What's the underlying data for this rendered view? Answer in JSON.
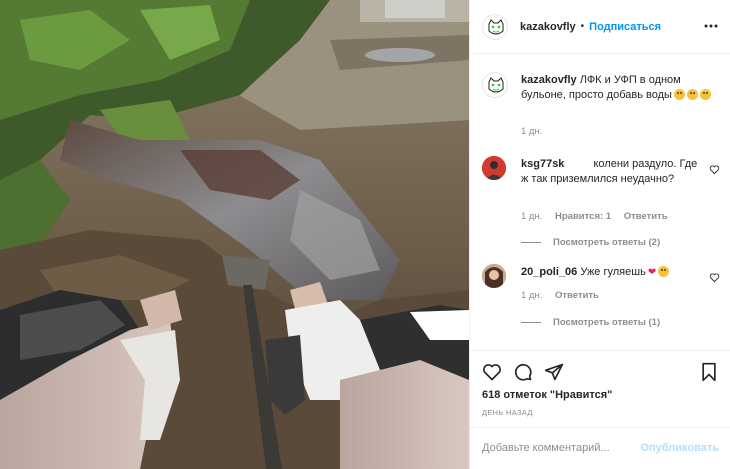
{
  "post": {
    "username": "kazakovfly",
    "follow_label": "Подписаться",
    "separator": "•",
    "more_icon": "more-horizontal-icon",
    "caption": {
      "username": "kazakovfly",
      "text": "ЛФК и УФП в одном бульоне, просто добавь воды",
      "time": "1 дн."
    },
    "comments": [
      {
        "username": "ksg77sk",
        "text": "колени раздуло. Где ж так приземлился неудачно?",
        "time": "1 дн.",
        "likes": "Нравится: 1",
        "reply_label": "Ответить",
        "replies_label": "Посмотреть ответы (2)"
      },
      {
        "username": "20_poli_06",
        "text": "Уже гуляешь",
        "time": "1 дн.",
        "reply_label": "Ответить",
        "replies_label": "Посмотреть ответы (1)"
      }
    ],
    "likes_text": "618 отметок \"Нравится\"",
    "date_text": "ДЕНЬ НАЗАД",
    "comment_placeholder": "Добавьте комментарий...",
    "post_label": "Опубликовать",
    "icons": [
      "heart-icon",
      "comment-icon",
      "share-icon",
      "bookmark-icon"
    ],
    "colors": {
      "accent": "#0095f6",
      "accent_disabled": "#b2dffc",
      "muted": "#8e8e8e",
      "text": "#262626"
    }
  }
}
